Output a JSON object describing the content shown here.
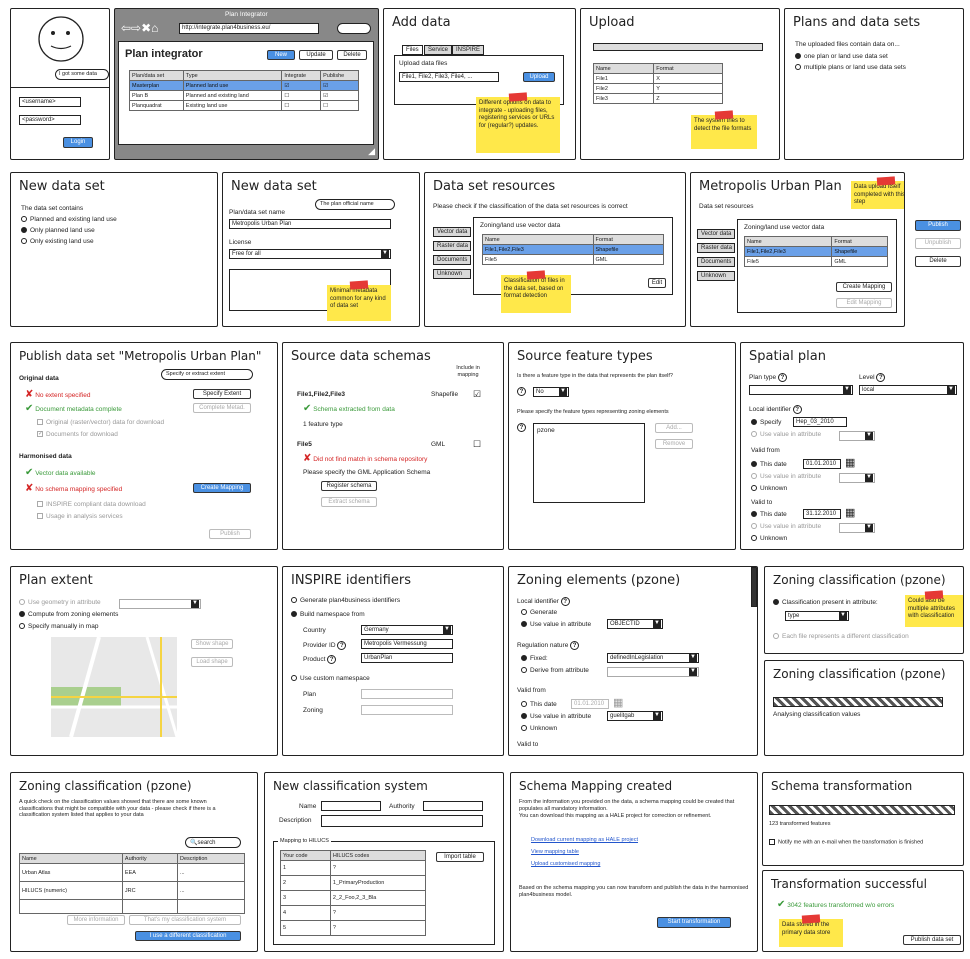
{
  "p1": {
    "speech": "I got some data",
    "username": "<username>",
    "password": "<password>",
    "login": "Login"
  },
  "p2": {
    "window_title": "Plan Integrator",
    "url": "http://integrate.plan4business.eu/",
    "title": "Plan integrator",
    "new": "New",
    "update": "Update",
    "delete": "Delete",
    "cols": [
      "Plan/data set",
      "Type",
      "Integrate",
      "Publishe"
    ],
    "rows": [
      {
        "name": "Masterplan",
        "type": "Planned land use",
        "integrate": "☑",
        "publish": "☑",
        "sel": true
      },
      {
        "name": "Plan B",
        "type": "Planned and existing land",
        "integrate": "☐",
        "publish": "☑",
        "sel": false
      },
      {
        "name": "Planquadrat",
        "type": "Existing land use",
        "integrate": "☐",
        "publish": "☐",
        "sel": false
      }
    ]
  },
  "p3": {
    "title": "Add data",
    "tabs": [
      "Files",
      "Service",
      "INSPIRE"
    ],
    "label": "Upload data files",
    "files": "File1, File2, File3, File4, ...",
    "upload": "Upload",
    "note": "Different options on data to integrate - uploading files, registering services or URLs for (regular?) updates."
  },
  "p4": {
    "title": "Upload",
    "cols": [
      "Name",
      "Format"
    ],
    "rows": [
      [
        "File1",
        "X"
      ],
      [
        "File2",
        "Y"
      ],
      [
        "File3",
        "Z"
      ]
    ],
    "note": "The system tries to detect the file formats"
  },
  "p5": {
    "title": "Plans and data sets",
    "desc": "The uploaded files contain data on...",
    "opt1": "one plan or land use data set",
    "opt2": "multiple plans or land use data sets"
  },
  "p6": {
    "title": "New data set",
    "desc": "The data set contains",
    "opt1": "Planned and existing land use",
    "opt2": "Only planned land use",
    "opt3": "Only existing land use"
  },
  "p7": {
    "title": "New data set",
    "bubble": "The plan official name",
    "name_label": "Plan/data set name",
    "name_value": "Metropolis Urban Plan",
    "license_label": "License",
    "license_value": "Free for all",
    "note": "Minimal metadata common for any kind of data set"
  },
  "p8": {
    "title": "Data set resources",
    "desc": "Please check if the classification of the data set resources is correct",
    "tabs": [
      "Vector data",
      "Raster data",
      "Documents",
      "Unknown"
    ],
    "inner_title": "Zoning/land use vector data",
    "cols": [
      "Name",
      "Format"
    ],
    "rows": [
      [
        "File1,File2,File3",
        "Shapefile"
      ],
      [
        "File5",
        "GML"
      ]
    ],
    "edit": "Edit",
    "note": "Classification of files in the data set, based on format detection"
  },
  "p9": {
    "title": "Metropolis Urban Plan",
    "desc": "Data set resources",
    "note": "Data upload itself completed with this step",
    "tabs": [
      "Vector data",
      "Raster data",
      "Documents",
      "Unknown"
    ],
    "inner_title": "Zoning/land use vector data",
    "cols": [
      "Name",
      "Format"
    ],
    "rows": [
      [
        "File1,File2,File3",
        "Shapefile"
      ],
      [
        "File5",
        "GML"
      ]
    ],
    "create_mapping": "Create Mapping",
    "edit_mapping": "Edit Mapping",
    "publish": "Publish",
    "unpublish": "Unpublish",
    "delete": "Delete"
  },
  "p10": {
    "title": "Publish data set \"Metropolis Urban Plan\"",
    "bubble": "Specify or extract extent",
    "orig_h": "Original data",
    "no_extent": "No extent specified",
    "specify_extent": "Specify Extent",
    "metadata_ok": "Document metadata complete",
    "complete_metad": "Complete Metad.",
    "orig_download": "Original (raster/vector) data for download",
    "docs_download": "Documents for download",
    "harm_h": "Harmonised data",
    "vector_avail": "Vector data available",
    "no_mapping": "No schema mapping specified",
    "create_mapping": "Create Mapping",
    "inspire_dl": "INSPIRE compliant data download",
    "usage": "Usage in analysis services",
    "publish": "Publish"
  },
  "p11": {
    "title": "Source data schemas",
    "include": "Include in mapping",
    "f1": "File1,File2,File3",
    "f1_format": "Shapefile",
    "f1_status": "Schema extracted from data",
    "f1_count": "1 feature type",
    "f2": "File5",
    "f2_format": "GML",
    "f2_status": "Did not find match in schema repository",
    "gml_prompt": "Please specify the GML Application Schema",
    "register": "Register schema",
    "extract": "Extract schema"
  },
  "p12": {
    "title": "Source feature types",
    "question": "Is there a feature type in the data that represents the plan itself?",
    "no": "No",
    "specify": "Please specify the feature types representing zoning elements",
    "list_item": "pzone",
    "add": "Add...",
    "remove": "Remove"
  },
  "p13": {
    "title": "Spatial plan",
    "plan_type": "Plan type",
    "level": "Level",
    "level_value": "local",
    "local_id": "Local identifier",
    "specify": "Specify",
    "specify_value": "Hep_03_2010",
    "use_attr": "Use value in attribute",
    "valid_from": "Valid from",
    "this_date": "This date",
    "from_date": "01.01.2010",
    "unknown": "Unknown",
    "valid_to": "Valid to",
    "to_date": "31.12.2010"
  },
  "p14": {
    "title": "Plan extent",
    "opt1": "Use geometry in attribute",
    "opt2": "Compute from zoning elements",
    "opt3": "Specify manually in map",
    "show": "Show shape",
    "load": "Load shape"
  },
  "p15": {
    "title": "INSPIRE identifiers",
    "gen": "Generate plan4business identifiers",
    "build": "Build namespace from",
    "country": "Country",
    "country_value": "Germany",
    "provider": "Provider ID",
    "provider_value": "Metropolis Vermessung",
    "product": "Product",
    "product_value": "UrbanPlan",
    "custom": "Use custom namespace",
    "plan": "Plan",
    "zoning": "Zoning"
  },
  "p16": {
    "title": "Zoning elements (pzone)",
    "local_id": "Local identifier",
    "generate": "Generate",
    "use_attr": "Use value in attribute",
    "attr_value": "OBJECTID",
    "reg_nature": "Regulation nature",
    "fixed": "Fixed:",
    "fixed_value": "definedInLegislation",
    "derive": "Derive from attribute",
    "valid_from": "Valid from",
    "this_date": "This date",
    "date_value": "01.01.2010",
    "use_attr2": "Use value in attribute",
    "attr2_value": "guelitgab",
    "unknown": "Unknown",
    "valid_to": "Valid to"
  },
  "p17": {
    "title": "Zoning classification (pzone)",
    "opt1": "Classification present in attribute:",
    "attr_value": "type",
    "opt2": "Each file represents a different classification",
    "note": "Could also be multiple attributes with classification"
  },
  "p18": {
    "title": "Zoning classification (pzone)",
    "status": "Analysing classification values"
  },
  "p19": {
    "title": "Zoning classification (pzone)",
    "desc": "A quick check on the classification values showed that there are some known classifications that might be compatible with your data - please check if there is a classification system listed that applies to your data",
    "search": "search",
    "cols": [
      "Name",
      "Authority",
      "Description"
    ],
    "rows": [
      [
        "Urban Atlas",
        "EEA",
        "..."
      ],
      [
        "HILUCS (numeric)",
        "JRC",
        "..."
      ]
    ],
    "more": "More information",
    "thats": "That's my classification system",
    "different": "I use a different classification"
  },
  "p20": {
    "title": "New classification system",
    "name": "Name",
    "authority": "Authority",
    "description": "Description",
    "mapping": "Mapping to HILUCS",
    "cols": [
      "Your code",
      "HILUCS codes"
    ],
    "rows": [
      [
        "1",
        "?"
      ],
      [
        "2",
        "1_PrimaryProduction"
      ],
      [
        "3",
        "2_2_Foo,2_3_Bla"
      ],
      [
        "4",
        "?"
      ],
      [
        "5",
        "?"
      ]
    ],
    "import": "Import table"
  },
  "p21": {
    "title": "Schema Mapping created",
    "desc1": "From the information you provided on the data, a schema mapping could be created that populates all mandatory information.",
    "desc2": "You can download this mapping as a HALE project for correction or refinement.",
    "link1": "Download current mapping as HALE project",
    "link2": "View mapping table",
    "link3": "Upload customised mapping",
    "desc3": "Based on the schema mapping you can now transform and publish the data in the harmonised plan4business model.",
    "start": "Start transformation"
  },
  "p22": {
    "title": "Schema transformation",
    "count": "123 transformed features",
    "notify": "Notify me with an e-mail when the transformation is finished"
  },
  "p23": {
    "title": "Transformation successful",
    "result": "3042 features transformed w/o errors",
    "note": "Data stored in the primary data store",
    "publish": "Publish data set"
  }
}
